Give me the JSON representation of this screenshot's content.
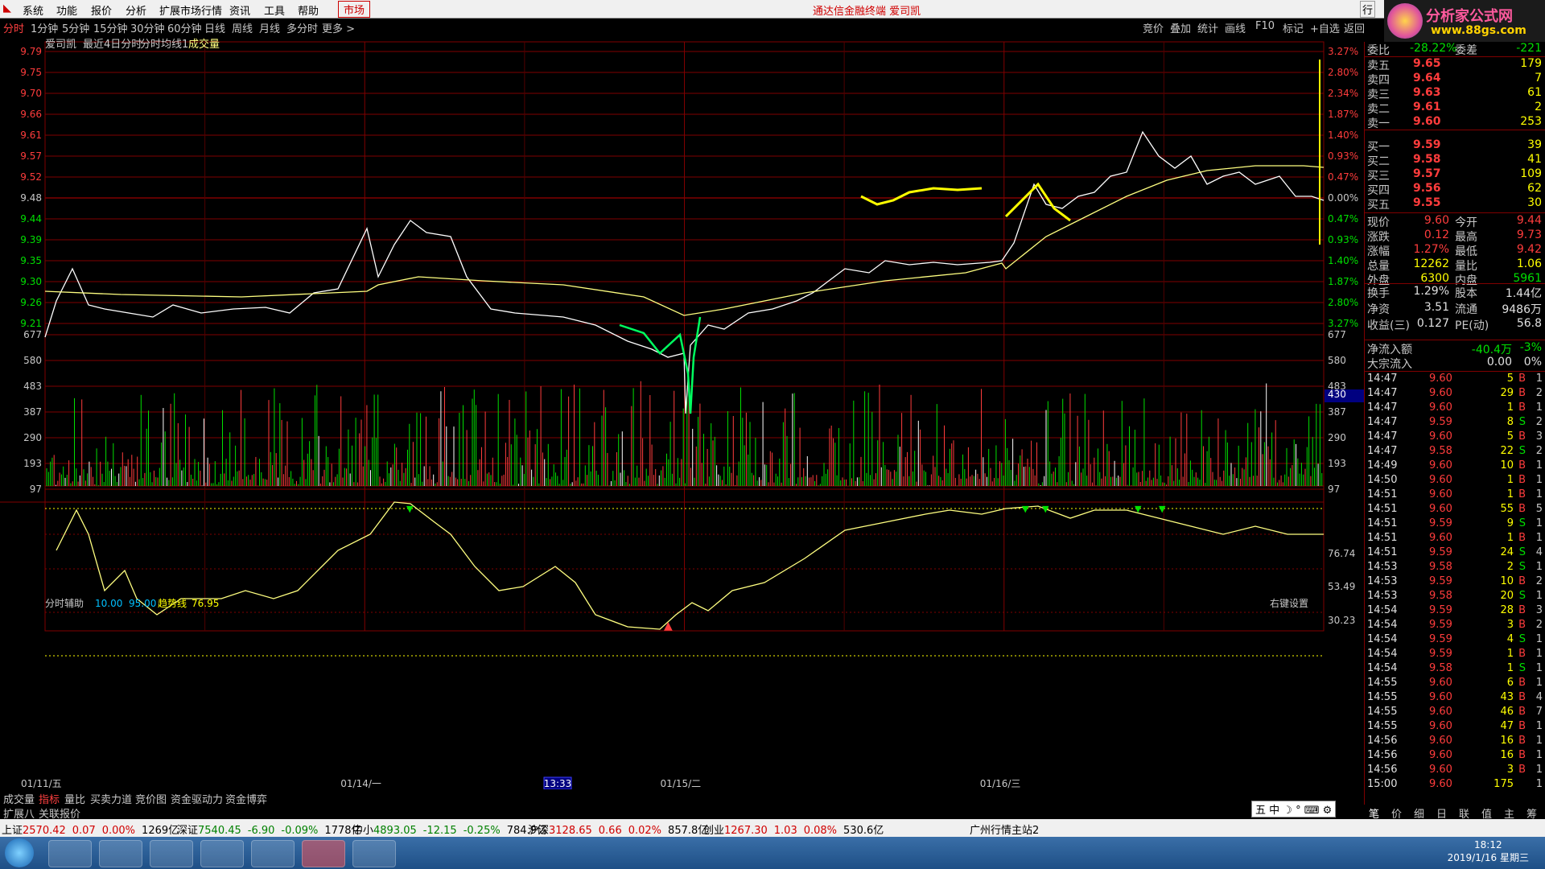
{
  "menu": {
    "items": [
      "系统",
      "功能",
      "报价",
      "分析",
      "扩展市场行情",
      "资讯",
      "工具",
      "帮助"
    ],
    "market_tab": "市场",
    "title": "通达信金融终端  爱司凯",
    "logo_line1": "分析家公式网",
    "logo_line2": "www.88gs.com"
  },
  "periods": [
    "分时",
    "1分钟",
    "5分钟",
    "15分钟",
    "30分钟",
    "60分钟",
    "日线",
    "周线",
    "月线",
    "多分时",
    "更多 >"
  ],
  "toolbar": [
    "竞价",
    "叠加",
    "统计",
    "画线",
    "F10",
    "标记",
    "+自选",
    "返回"
  ],
  "chart_header": {
    "name": "爱司凯",
    "desc": "最近4日分时",
    "ma_label": "分时均线1",
    "vol_label": "成交量"
  },
  "price_axis_left": [
    "9.79",
    "9.75",
    "9.70",
    "9.66",
    "9.61",
    "9.57",
    "9.52",
    "9.48",
    "9.44",
    "9.39",
    "9.35",
    "9.30",
    "9.26",
    "9.21"
  ],
  "pct_axis_right": [
    "3.27%",
    "2.80%",
    "2.34%",
    "1.87%",
    "1.40%",
    "0.93%",
    "0.47%",
    "0.00%",
    "0.47%",
    "0.93%",
    "1.40%",
    "1.87%",
    "2.80%",
    "3.27%"
  ],
  "vol_axis": [
    "677",
    "580",
    "483",
    "387",
    "290",
    "193",
    "97"
  ],
  "vol_cursor": "430",
  "indicator": {
    "name": "分时辅助",
    "p1": "10.00",
    "p2": "95.00",
    "trend_label": "趋势线",
    "trend_value": "76.95",
    "right_setting": "右键设置",
    "axis": [
      "76.74",
      "53.49",
      "30.23"
    ]
  },
  "date_axis": [
    "01/11/五",
    "01/14/一",
    "01/15/二",
    "01/16/三"
  ],
  "time_cursor": "13:33",
  "bottom_tabs": [
    "成交量",
    "指标",
    "量比",
    "买卖力道",
    "竞价图",
    "资金驱动力",
    "资金博弈"
  ],
  "bottom_tabs2": [
    "扩展八",
    "关联报价"
  ],
  "rp_bottom_tabs": [
    "笔",
    "价",
    "细",
    "日",
    "联",
    "值",
    "主",
    "筹"
  ],
  "quote": {
    "wb_label": "委比",
    "wb": "-28.22%",
    "wc_label": "委差",
    "wc": "-221",
    "asks": [
      {
        "label": "卖五",
        "price": "9.65",
        "vol": "179"
      },
      {
        "label": "卖四",
        "price": "9.64",
        "vol": "7"
      },
      {
        "label": "卖三",
        "price": "9.63",
        "vol": "61"
      },
      {
        "label": "卖二",
        "price": "9.61",
        "vol": "2"
      },
      {
        "label": "卖一",
        "price": "9.60",
        "vol": "253"
      }
    ],
    "bids": [
      {
        "label": "买一",
        "price": "9.59",
        "vol": "39"
      },
      {
        "label": "买二",
        "price": "9.58",
        "vol": "41"
      },
      {
        "label": "买三",
        "price": "9.57",
        "vol": "109"
      },
      {
        "label": "买四",
        "price": "9.56",
        "vol": "62"
      },
      {
        "label": "买五",
        "price": "9.55",
        "vol": "30"
      }
    ],
    "stats": [
      {
        "l1": "现价",
        "v1": "9.60",
        "l2": "今开",
        "v2": "9.44"
      },
      {
        "l1": "涨跌",
        "v1": "0.12",
        "l2": "最高",
        "v2": "9.73"
      },
      {
        "l1": "涨幅",
        "v1": "1.27%",
        "l2": "最低",
        "v2": "9.42"
      },
      {
        "l1": "总量",
        "v1": "12262",
        "l2": "量比",
        "v2": "1.06"
      },
      {
        "l1": "外盘",
        "v1": "6300",
        "l2": "内盘",
        "v2": "5961"
      }
    ],
    "stats2": [
      {
        "l1": "换手",
        "v1": "1.29%",
        "l2": "股本",
        "v2": "1.44亿"
      },
      {
        "l1": "净资",
        "v1": "3.51",
        "l2": "流通",
        "v2": "9486万"
      },
      {
        "l1": "收益(三)",
        "v1": "0.127",
        "l2": "PE(动)",
        "v2": "56.8"
      }
    ],
    "flow": [
      {
        "l": "净流入额",
        "v": "-40.4万",
        "p": "-3%"
      },
      {
        "l": "大宗流入",
        "v": "0.00",
        "p": "0%"
      }
    ]
  },
  "ticks": [
    {
      "t": "14:47",
      "p": "9.60",
      "v": "5",
      "bs": "B",
      "n": "1"
    },
    {
      "t": "14:47",
      "p": "9.60",
      "v": "29",
      "bs": "B",
      "n": "2"
    },
    {
      "t": "14:47",
      "p": "9.60",
      "v": "1",
      "bs": "B",
      "n": "1"
    },
    {
      "t": "14:47",
      "p": "9.59",
      "v": "8",
      "bs": "S",
      "n": "2"
    },
    {
      "t": "14:47",
      "p": "9.60",
      "v": "5",
      "bs": "B",
      "n": "3"
    },
    {
      "t": "14:47",
      "p": "9.58",
      "v": "22",
      "bs": "S",
      "n": "2"
    },
    {
      "t": "14:49",
      "p": "9.60",
      "v": "10",
      "bs": "B",
      "n": "1"
    },
    {
      "t": "14:50",
      "p": "9.60",
      "v": "1",
      "bs": "B",
      "n": "1"
    },
    {
      "t": "14:51",
      "p": "9.60",
      "v": "1",
      "bs": "B",
      "n": "1"
    },
    {
      "t": "14:51",
      "p": "9.60",
      "v": "55",
      "bs": "B",
      "n": "5"
    },
    {
      "t": "14:51",
      "p": "9.59",
      "v": "9",
      "bs": "S",
      "n": "1"
    },
    {
      "t": "14:51",
      "p": "9.60",
      "v": "1",
      "bs": "B",
      "n": "1"
    },
    {
      "t": "14:51",
      "p": "9.59",
      "v": "24",
      "bs": "S",
      "n": "4"
    },
    {
      "t": "14:53",
      "p": "9.58",
      "v": "2",
      "bs": "S",
      "n": "1"
    },
    {
      "t": "14:53",
      "p": "9.59",
      "v": "10",
      "bs": "B",
      "n": "2"
    },
    {
      "t": "14:53",
      "p": "9.58",
      "v": "20",
      "bs": "S",
      "n": "1"
    },
    {
      "t": "14:54",
      "p": "9.59",
      "v": "28",
      "bs": "B",
      "n": "3"
    },
    {
      "t": "14:54",
      "p": "9.59",
      "v": "3",
      "bs": "B",
      "n": "2"
    },
    {
      "t": "14:54",
      "p": "9.59",
      "v": "4",
      "bs": "S",
      "n": "1"
    },
    {
      "t": "14:54",
      "p": "9.59",
      "v": "1",
      "bs": "B",
      "n": "1"
    },
    {
      "t": "14:54",
      "p": "9.58",
      "v": "1",
      "bs": "S",
      "n": "1"
    },
    {
      "t": "14:55",
      "p": "9.60",
      "v": "6",
      "bs": "B",
      "n": "1"
    },
    {
      "t": "14:55",
      "p": "9.60",
      "v": "43",
      "bs": "B",
      "n": "4"
    },
    {
      "t": "14:55",
      "p": "9.60",
      "v": "46",
      "bs": "B",
      "n": "7"
    },
    {
      "t": "14:55",
      "p": "9.60",
      "v": "47",
      "bs": "B",
      "n": "1"
    },
    {
      "t": "14:56",
      "p": "9.60",
      "v": "16",
      "bs": "B",
      "n": "1"
    },
    {
      "t": "14:56",
      "p": "9.60",
      "v": "16",
      "bs": "B",
      "n": "1"
    },
    {
      "t": "14:56",
      "p": "9.60",
      "v": "3",
      "bs": "B",
      "n": "1"
    },
    {
      "t": "15:00",
      "p": "9.60",
      "v": "175",
      "bs": "",
      "n": "1"
    }
  ],
  "status": [
    {
      "name": "上证",
      "val": "2570.42",
      "chg": "0.07",
      "pct": "0.00%",
      "amt": "1269亿"
    },
    {
      "name": "深证",
      "val": "7540.45",
      "chg": "-6.90",
      "pct": "-0.09%",
      "amt": "1778亿"
    },
    {
      "name": "中小",
      "val": "4893.05",
      "chg": "-12.15",
      "pct": "-0.25%",
      "amt": "784.9亿"
    },
    {
      "name": "沪深",
      "val": "3128.65",
      "chg": "0.66",
      "pct": "0.02%",
      "amt": "857.8亿"
    },
    {
      "name": "创业",
      "val": "1267.30",
      "chg": "1.03",
      "pct": "0.08%",
      "amt": "530.6亿"
    }
  ],
  "status_site": "广州行情主站2",
  "clock": {
    "time": "18:12",
    "date": "2019/1/16 星期三"
  },
  "ime": "中",
  "colors": {
    "up": "#ff3c3c",
    "down": "#00e000",
    "grid": "#800000",
    "price": "#ffffff",
    "avg": "#ffff80"
  },
  "chart_data": {
    "type": "line",
    "title": "爱司凯 最近4日分时",
    "days": [
      "01/11/五",
      "01/14/一",
      "01/15/二",
      "01/16/三"
    ],
    "price_range": [
      9.21,
      9.79
    ],
    "prev_close": 9.48
  }
}
